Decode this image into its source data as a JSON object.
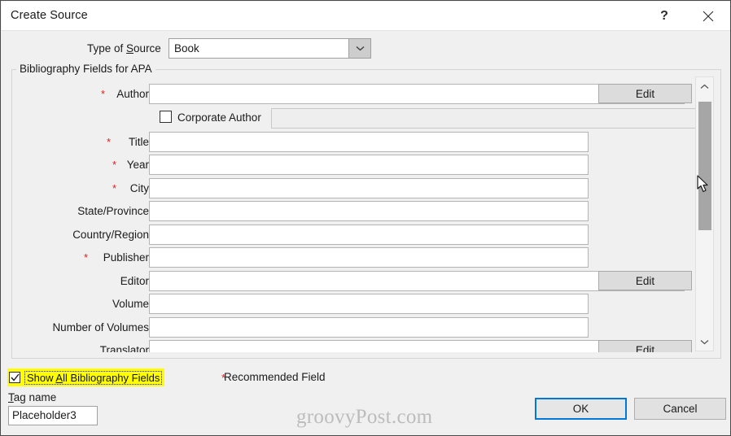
{
  "window": {
    "title": "Create Source",
    "help_icon": "question-mark-icon",
    "close_icon": "close-icon"
  },
  "type_of_source": {
    "label_pre": "Type of ",
    "label_accel": "S",
    "label_post": "ource",
    "value": "Book",
    "arrow_icon": "chevron-down-icon"
  },
  "group": {
    "legend": "Bibliography Fields for APA"
  },
  "fields": [
    {
      "label": "Author",
      "required": true,
      "edit": "Edit",
      "input": "wide",
      "disabled": false
    },
    {
      "label": "Corporate Author",
      "required": false,
      "edit": null,
      "input": "checkbox",
      "disabled": true
    },
    {
      "label": "Title",
      "required": true,
      "edit": null,
      "input": "narrow",
      "disabled": false
    },
    {
      "label": "Year",
      "required": true,
      "edit": null,
      "input": "narrow",
      "disabled": false
    },
    {
      "label": "City",
      "required": true,
      "edit": null,
      "input": "narrow",
      "disabled": false
    },
    {
      "label": "State/Province",
      "required": false,
      "edit": null,
      "input": "narrow",
      "disabled": false
    },
    {
      "label": "Country/Region",
      "required": false,
      "edit": null,
      "input": "narrow",
      "disabled": false
    },
    {
      "label": "Publisher",
      "required": true,
      "edit": null,
      "input": "narrow",
      "disabled": false
    },
    {
      "label": "Editor",
      "required": false,
      "edit": "Edit",
      "input": "wide",
      "disabled": false
    },
    {
      "label": "Volume",
      "required": false,
      "edit": null,
      "input": "narrow",
      "disabled": false
    },
    {
      "label": "Number of Volumes",
      "required": false,
      "edit": null,
      "input": "narrow",
      "disabled": false
    },
    {
      "label": "Translator",
      "required": false,
      "edit": "Edit",
      "input": "wide",
      "disabled": false
    }
  ],
  "scrollbar": {
    "up_icon": "chevron-up-icon",
    "down_icon": "chevron-down-icon"
  },
  "show_all": {
    "checked": true,
    "label_pre": "Show ",
    "label_accel": "A",
    "label_post": "ll Bibliography Fields",
    "highlight_color": "#ffff00",
    "check_icon": "checkmark-icon"
  },
  "recommended": {
    "star": "*",
    "text": "Recommended Field",
    "star_color": "#e02020"
  },
  "tag": {
    "label_accel": "T",
    "label_post": "ag name",
    "value": "Placeholder3"
  },
  "watermark": {
    "text": "groovyPost.com"
  },
  "buttons": {
    "ok": "OK",
    "cancel": "Cancel"
  }
}
